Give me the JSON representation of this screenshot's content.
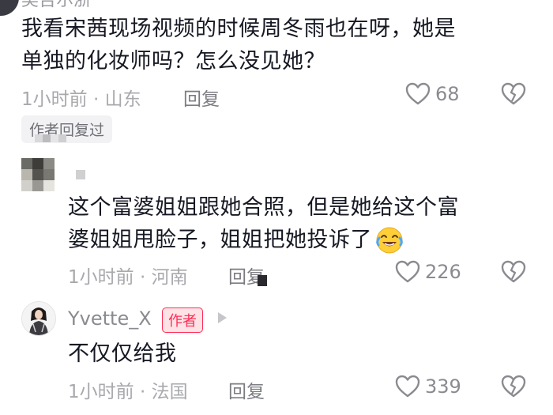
{
  "comments": [
    {
      "username": "吴吉尔浙",
      "text_line1": "我看宋茜现场视频的时候周冬雨也在呀，她是",
      "text_line2": "单独的化妆师吗？怎么没见她？",
      "time": "1小时前 · 山东",
      "reply_label": "回复",
      "likes": "68",
      "author_replied_label": "作者回复过"
    },
    {
      "text_line1": "这个富婆姐姐跟她合照，但是她给这个富",
      "text_line2": "婆姐姐甩脸子，姐姐把她投诉了",
      "emoji_icon": "crying-laughing-emoji",
      "time": "1小时前 · 河南",
      "reply_label": "回复",
      "likes": "226"
    },
    {
      "username": "Yvette_X",
      "author_badge": "作者",
      "text": "不仅仅给我",
      "time": "1小时前 · 法国",
      "reply_label": "回复",
      "likes": "339"
    }
  ],
  "colors": {
    "accent": "#fe2c55",
    "meta": "#a8a9ad",
    "text": "#161823"
  }
}
